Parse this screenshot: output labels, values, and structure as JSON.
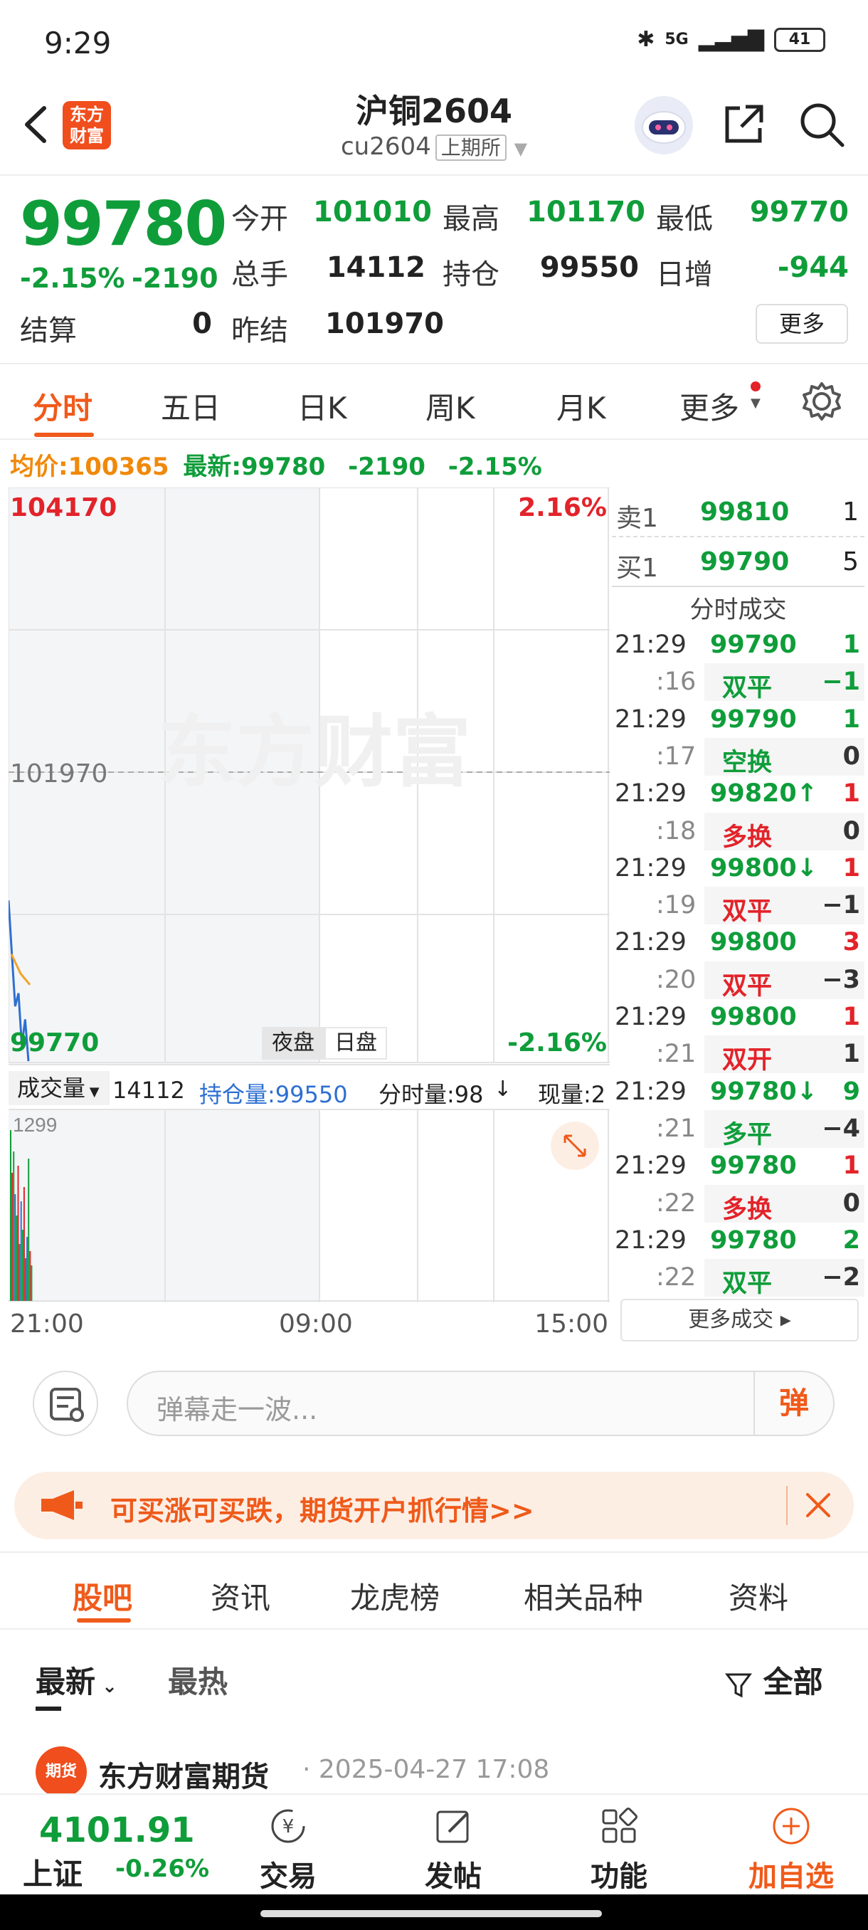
{
  "status": {
    "time": "9:29",
    "network": "5G",
    "battery": "41"
  },
  "header": {
    "title": "沪铜2604",
    "code": "cu2604",
    "exchange": "上期所",
    "logo_text_1": "东方",
    "logo_text_2": "财富"
  },
  "quote": {
    "price": "99780",
    "pct": "-2.15%",
    "change": "-2190",
    "open_label": "今开",
    "open": "101010",
    "high_label": "最高",
    "high": "101170",
    "low_label": "最低",
    "low": "99770",
    "volume_label": "总手",
    "volume": "14112",
    "oi_label": "持仓",
    "oi": "99550",
    "daily_inc_label": "日增",
    "daily_inc": "-944",
    "settle_label": "结算",
    "settle": "0",
    "prev_settle_label": "昨结",
    "prev_settle": "101970",
    "more": "更多"
  },
  "tabs": [
    "分时",
    "五日",
    "日K",
    "周K",
    "月K",
    "更多"
  ],
  "infoline": {
    "avg_label": "均价:",
    "avg": "100365",
    "latest_label": "最新:",
    "latest": "99780",
    "chg": "-2190",
    "pct": "-2.15%"
  },
  "chart": {
    "top_price": "104170",
    "top_pct": "2.16%",
    "mid_price": "101970",
    "bottom_price": "99770",
    "bottom_pct": "-2.16%",
    "session_night": "夜盘",
    "session_day": "日盘",
    "watermark": "东方财富",
    "vol_label": "成交量",
    "vol_value": "14112",
    "oi_label": "持仓量:99550",
    "tick_vol": "分时量:98",
    "cur_vol": "现量:2",
    "vol_max": "1299",
    "x_labels": [
      "21:00",
      "09:00",
      "15:00"
    ]
  },
  "chart_data": {
    "type": "line",
    "x_axis": [
      "21:00",
      "09:00",
      "15:00"
    ],
    "ylim": [
      99770,
      104170
    ],
    "reference": 101970,
    "series": [
      {
        "values": [
          101010,
          100600,
          100200,
          100300,
          99900,
          100100,
          99780
        ]
      },
      {
        "values": [
          100600,
          100450,
          100365
        ]
      }
    ]
  },
  "book": {
    "ask_label": "卖1",
    "ask_price": "99810",
    "ask_vol": "1",
    "bid_label": "买1",
    "bid_price": "99790",
    "bid_vol": "5",
    "ticks_title": "分时成交",
    "more_ticks": "更多成交",
    "ticks": [
      {
        "t": "21:29",
        "p": "99790",
        "v": "1",
        "pc": "green",
        "vc": "green",
        "arrow": ""
      },
      {
        "t": ":16",
        "p": "双平",
        "v": "−1",
        "pc": "green",
        "vc": "green",
        "sub": true
      },
      {
        "t": "21:29",
        "p": "99790",
        "v": "1",
        "pc": "green",
        "vc": "green",
        "arrow": ""
      },
      {
        "t": ":17",
        "p": "空换",
        "v": "0",
        "pc": "green",
        "vc": "gray",
        "sub": true
      },
      {
        "t": "21:29",
        "p": "99820",
        "v": "1",
        "pc": "green",
        "vc": "red",
        "arrow": "↑"
      },
      {
        "t": ":18",
        "p": "多换",
        "v": "0",
        "pc": "red",
        "vc": "gray",
        "sub": true
      },
      {
        "t": "21:29",
        "p": "99800",
        "v": "1",
        "pc": "green",
        "vc": "red",
        "arrow": "↓"
      },
      {
        "t": ":19",
        "p": "双平",
        "v": "−1",
        "pc": "red",
        "vc": "gray",
        "sub": true
      },
      {
        "t": "21:29",
        "p": "99800",
        "v": "3",
        "pc": "green",
        "vc": "red",
        "arrow": ""
      },
      {
        "t": ":20",
        "p": "双平",
        "v": "−3",
        "pc": "red",
        "vc": "gray",
        "sub": true
      },
      {
        "t": "21:29",
        "p": "99800",
        "v": "1",
        "pc": "green",
        "vc": "red",
        "arrow": ""
      },
      {
        "t": ":21",
        "p": "双开",
        "v": "1",
        "pc": "red",
        "vc": "gray",
        "sub": true
      },
      {
        "t": "21:29",
        "p": "99780",
        "v": "9",
        "pc": "green",
        "vc": "green",
        "arrow": "↓"
      },
      {
        "t": ":21",
        "p": "多平",
        "v": "−4",
        "pc": "green",
        "vc": "gray",
        "sub": true
      },
      {
        "t": "21:29",
        "p": "99780",
        "v": "1",
        "pc": "green",
        "vc": "red",
        "arrow": ""
      },
      {
        "t": ":22",
        "p": "多换",
        "v": "0",
        "pc": "red",
        "vc": "gray",
        "sub": true
      },
      {
        "t": "21:29",
        "p": "99780",
        "v": "2",
        "pc": "green",
        "vc": "green",
        "arrow": ""
      },
      {
        "t": ":22",
        "p": "双平",
        "v": "−2",
        "pc": "green",
        "vc": "gray",
        "sub": true
      }
    ]
  },
  "danmu": {
    "placeholder": "弹幕走一波...",
    "button": "弹"
  },
  "banner": {
    "text": "可买涨可买跌，期货开户抓行情>>"
  },
  "section_tabs": [
    "股吧",
    "资讯",
    "龙虎榜",
    "相关品种",
    "资料"
  ],
  "filter": {
    "latest": "最新",
    "hot": "最热",
    "all": "全部"
  },
  "post": {
    "author": "东方财富期货",
    "date": "2025-04-27 17:08",
    "avatar_text": "期货"
  },
  "bottom_nav": {
    "index_value": "4101.91",
    "index_name": "上证",
    "index_pct": "-0.26%",
    "trade": "交易",
    "post": "发帖",
    "function": "功能",
    "add": "加自选"
  },
  "colors": {
    "accent": "#f05a1a",
    "up": "#e2232a",
    "down": "#0f9d3a",
    "avg": "#f0a42b",
    "line": "#2e6fd1"
  }
}
